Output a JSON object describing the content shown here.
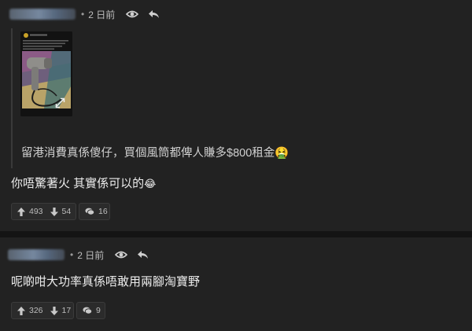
{
  "posts": [
    {
      "time": "2 日前",
      "quote": {
        "text": "留港消費真係傻仔，買個風筒都俾人賺多$800租金",
        "emoji": "🤮"
      },
      "body": "你唔驚著火 其實係可以的",
      "body_emoji": "😂",
      "actions": {
        "upvotes": "493",
        "downvotes": "54",
        "comments": "16"
      }
    },
    {
      "time": "2 日前",
      "body": "呢啲咁大功率真係唔敢用兩腳淘寶野",
      "actions": {
        "upvotes": "326",
        "downvotes": "17",
        "comments": "9"
      }
    }
  ],
  "icons": [
    "eye-icon",
    "reply-icon",
    "arrow-up-icon",
    "arrow-down-icon",
    "comment-icon",
    "expand-icon"
  ],
  "colors": {
    "background": "#222222",
    "separator": "#141414",
    "text": "#e6e6e6",
    "muted": "#bdbdbd"
  }
}
